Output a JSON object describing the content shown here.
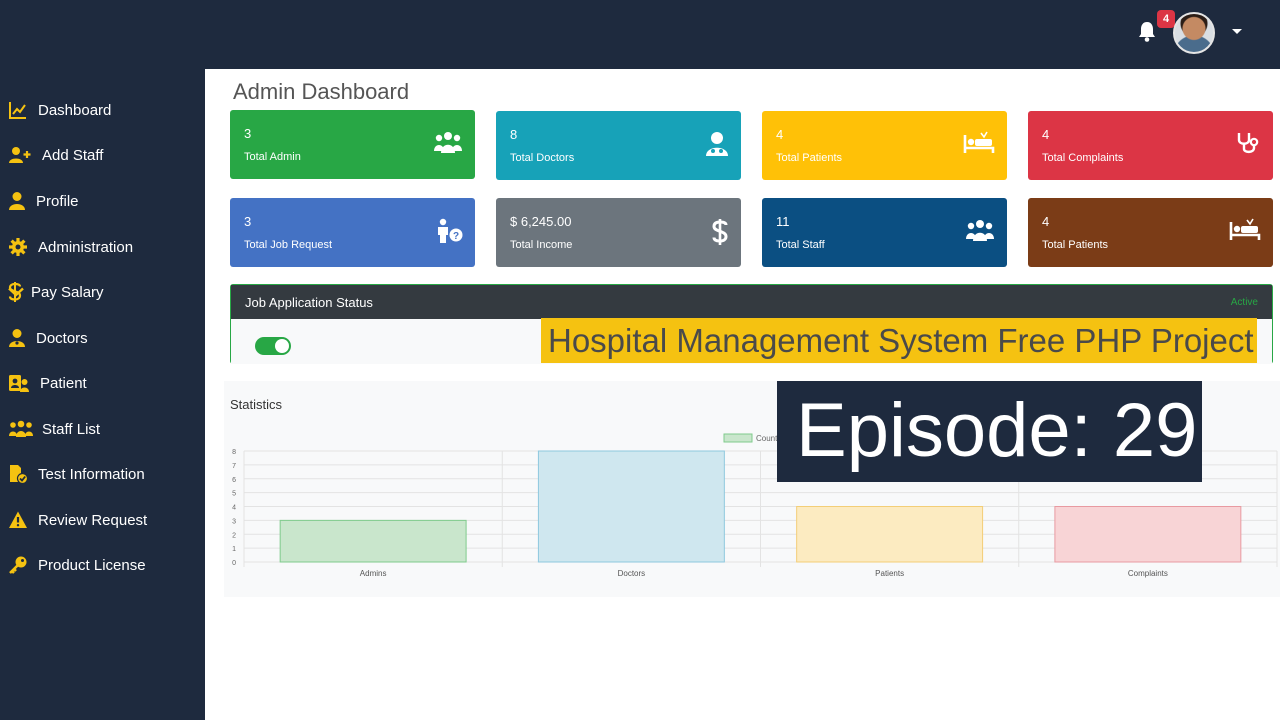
{
  "topbar": {
    "notification_count": "4"
  },
  "sidebar": {
    "items": [
      {
        "label": "Dashboard",
        "icon": "chart-line-icon"
      },
      {
        "label": "Add Staff",
        "icon": "user-plus-icon"
      },
      {
        "label": "Profile",
        "icon": "user-icon"
      },
      {
        "label": "Administration",
        "icon": "cog-icon"
      },
      {
        "label": "Pay Salary",
        "icon": "dollar-icon"
      },
      {
        "label": "Doctors",
        "icon": "user-md-icon"
      },
      {
        "label": "Patient",
        "icon": "id-card-icon"
      },
      {
        "label": "Staff List",
        "icon": "users-icon"
      },
      {
        "label": "Test Information",
        "icon": "file-check-icon"
      },
      {
        "label": "Review Request",
        "icon": "warning-icon"
      },
      {
        "label": "Product License",
        "icon": "key-icon"
      }
    ]
  },
  "page_title": "Admin Dashboard",
  "cards": [
    {
      "value": "3",
      "label": "Total Admin",
      "color": "#28a745",
      "icon": "users-icon"
    },
    {
      "value": "8",
      "label": "Total Doctors",
      "color": "#17a2b8",
      "icon": "user-md-icon"
    },
    {
      "value": "4",
      "label": "Total Patients",
      "color": "#ffc107",
      "icon": "bed-icon"
    },
    {
      "value": "4",
      "label": "Total Complaints",
      "color": "#dc3545",
      "icon": "stethoscope-icon"
    },
    {
      "value": "3",
      "label": "Total Job Request",
      "color": "#4472c4",
      "icon": "user-question-icon"
    },
    {
      "value": "$ 6,245.00",
      "label": "Total Income",
      "color": "#6c757d",
      "icon": "dollar-icon"
    },
    {
      "value": "11",
      "label": "Total Staff",
      "color": "#0b4f82",
      "icon": "users-icon"
    },
    {
      "value": "4",
      "label": "Total Patients",
      "color": "#7b3c17",
      "icon": "bed-icon"
    }
  ],
  "job_status": {
    "title": "Job Application Status",
    "status": "Active"
  },
  "statistics": {
    "title": "Statistics"
  },
  "chart_data": {
    "type": "bar",
    "categories": [
      "Admins",
      "Doctors",
      "Patients",
      "Complaints"
    ],
    "series": [
      {
        "name": "Count",
        "values": [
          3,
          8,
          4,
          4
        ]
      }
    ],
    "colors": [
      "#c9e6cc",
      "#cfe7ef",
      "#fcebc1",
      "#f8d4d6"
    ],
    "borders": [
      "#7fcb8c",
      "#8ec8de",
      "#f3ce77",
      "#e89aa1"
    ],
    "ylim": [
      0,
      8
    ],
    "yticks": [
      "0",
      "1",
      "2",
      "3",
      "4",
      "5",
      "6",
      "7",
      "8"
    ],
    "legend": "top"
  },
  "overlay": {
    "banner_title": "Hospital Management System Free PHP Project",
    "episode": "Episode: 29"
  }
}
